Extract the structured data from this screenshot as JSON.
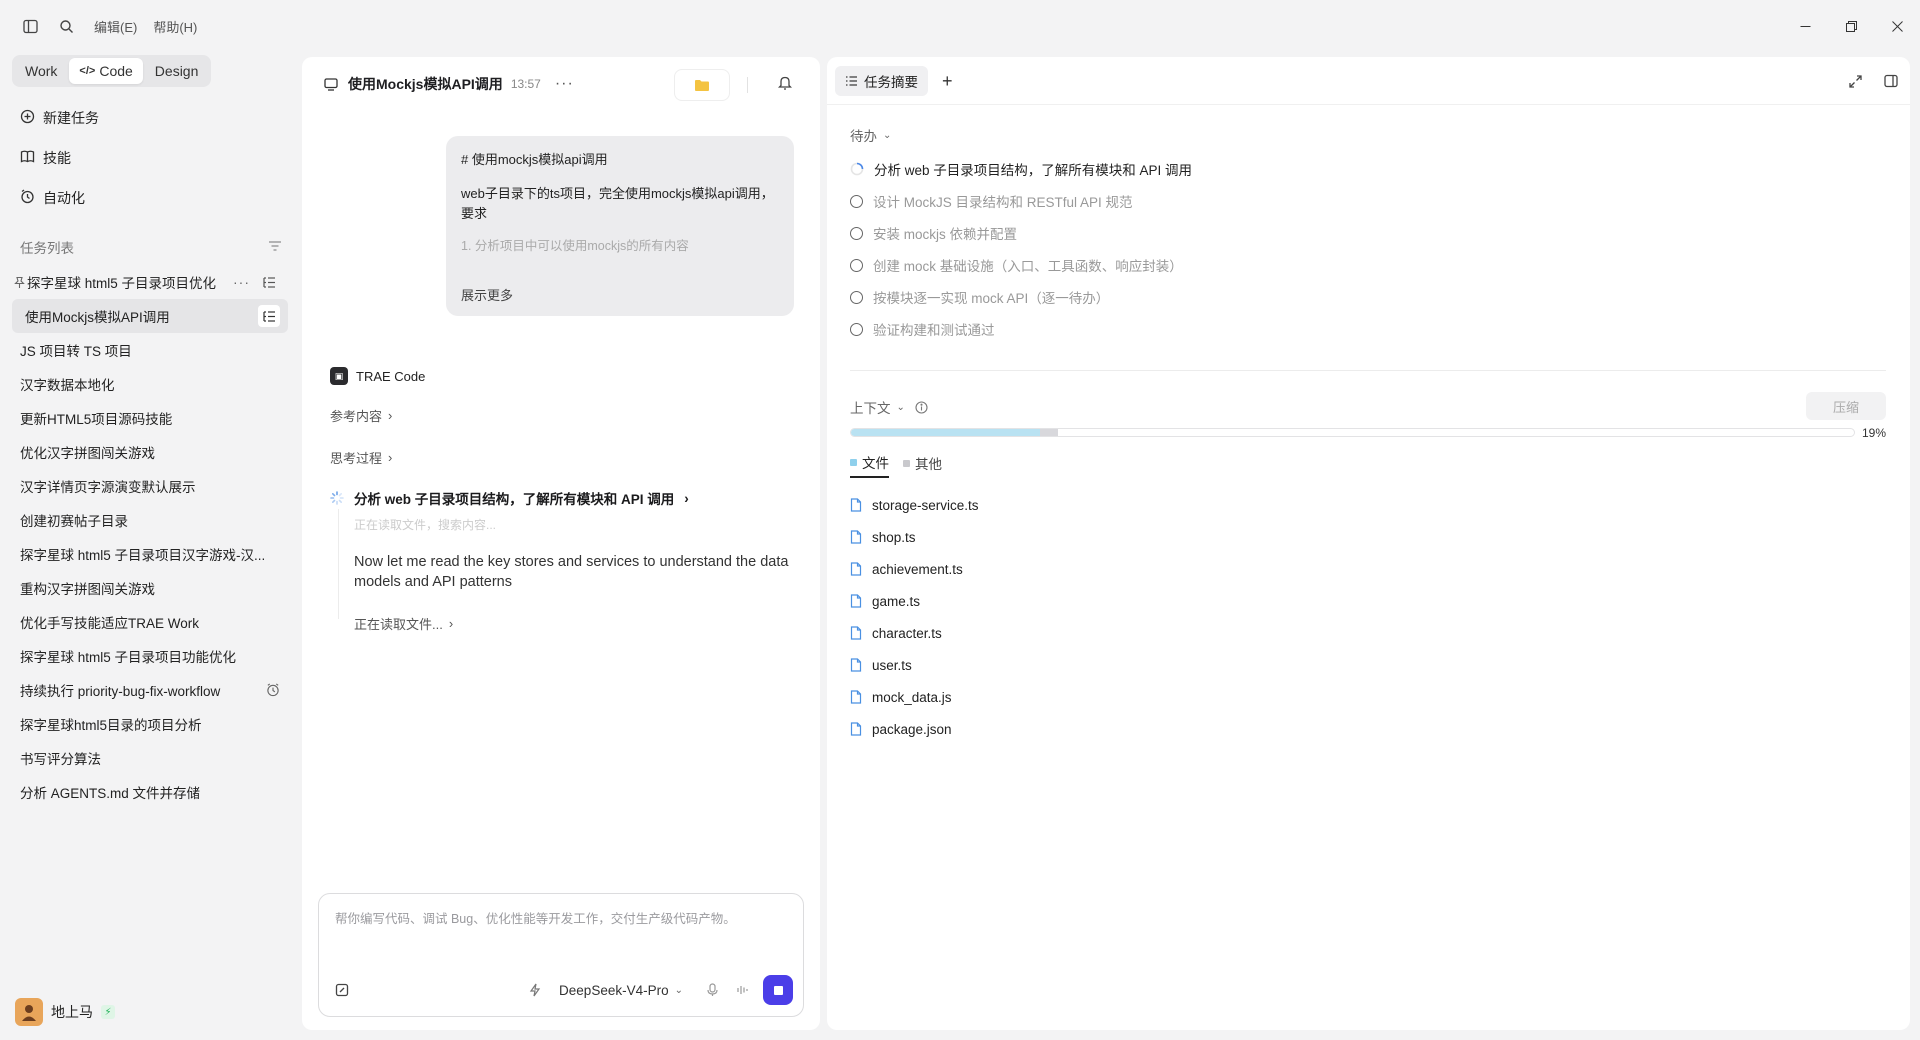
{
  "titlebar": {
    "menus": [
      "编辑(E)",
      "帮助(H)"
    ]
  },
  "sidebar": {
    "modes": [
      {
        "label": "Work",
        "active": false
      },
      {
        "label": "Code",
        "active": true
      },
      {
        "label": "Design",
        "active": false
      }
    ],
    "nav": [
      {
        "label": "新建任务",
        "icon": "new-task-icon"
      },
      {
        "label": "技能",
        "icon": "book-icon"
      },
      {
        "label": "自动化",
        "icon": "clock-icon"
      }
    ],
    "task_header": "任务列表",
    "tasks": [
      {
        "label": "探字星球 html5 子目录项目优化",
        "pinned": true
      },
      {
        "label": "使用Mockjs模拟API调用",
        "active": true
      },
      {
        "label": "JS 项目转 TS 项目"
      },
      {
        "label": "汉字数据本地化"
      },
      {
        "label": "更新HTML5项目源码技能"
      },
      {
        "label": "优化汉字拼图闯关游戏"
      },
      {
        "label": "汉字详情页字源演变默认展示"
      },
      {
        "label": "创建初赛帖子目录"
      },
      {
        "label": "探字星球 html5 子目录项目汉字游戏-汉..."
      },
      {
        "label": "重构汉字拼图闯关游戏"
      },
      {
        "label": "优化手写技能适应TRAE Work"
      },
      {
        "label": "探字星球 html5 子目录项目功能优化"
      },
      {
        "label": "持续执行 priority-bug-fix-workflow",
        "scheduled": true
      },
      {
        "label": "探字星球html5目录的项目分析"
      },
      {
        "label": "书写评分算法"
      },
      {
        "label": "分析 AGENTS.md 文件并存储"
      }
    ],
    "user": {
      "name": "地上马"
    }
  },
  "chat": {
    "title": "使用Mockjs模拟API调用",
    "time": "13:57",
    "user_message": {
      "line1": "# 使用mockjs模拟api调用",
      "line2": "web子目录下的ts项目，完全使用mockjs模拟api调用，要求",
      "line3": "1. 分析项目中可以使用mockjs的所有内容",
      "show_more": "展示更多"
    },
    "assistant_name": "TRAE Code",
    "reference": "参考内容",
    "thinking": "思考过程",
    "step_title": "分析 web 子目录项目结构，了解所有模块和 API 调用",
    "step_ghost": "正在读取文件，搜索内容...",
    "step_body": "Now let me read the key stores and services to understand the data models and API patterns",
    "reading": "正在读取文件...",
    "input_placeholder": "帮你编写代码、调试 Bug、优化性能等开发工作，交付生产级代码产物。",
    "model": "DeepSeek-V4-Pro"
  },
  "summary": {
    "tab_label": "任务摘要",
    "todo_label": "待办",
    "todos": [
      {
        "label": "分析 web 子目录项目结构，了解所有模块和 API 调用",
        "status": "in-progress"
      },
      {
        "label": "设计 MockJS 目录结构和 RESTful API 规范",
        "status": "pending"
      },
      {
        "label": "安装 mockjs 依赖并配置",
        "status": "pending"
      },
      {
        "label": "创建 mock 基础设施（入口、工具函数、响应封装）",
        "status": "pending"
      },
      {
        "label": "按模块逐一实现 mock API（逐一待办）",
        "status": "pending"
      },
      {
        "label": "验证构建和测试通过",
        "status": "pending"
      }
    ],
    "context_label": "上下文",
    "compress_label": "压缩",
    "context_percent": "19%",
    "context_files_fraction": 0.188,
    "context_other_fraction": 0.018,
    "ctx_tabs": [
      {
        "label": "文件",
        "color": "#8fd0ec",
        "active": true
      },
      {
        "label": "其他",
        "color": "#c9c9cd",
        "active": false
      }
    ],
    "files": [
      "storage-service.ts",
      "shop.ts",
      "achievement.ts",
      "game.ts",
      "character.ts",
      "user.ts",
      "mock_data.js",
      "package.json"
    ]
  }
}
